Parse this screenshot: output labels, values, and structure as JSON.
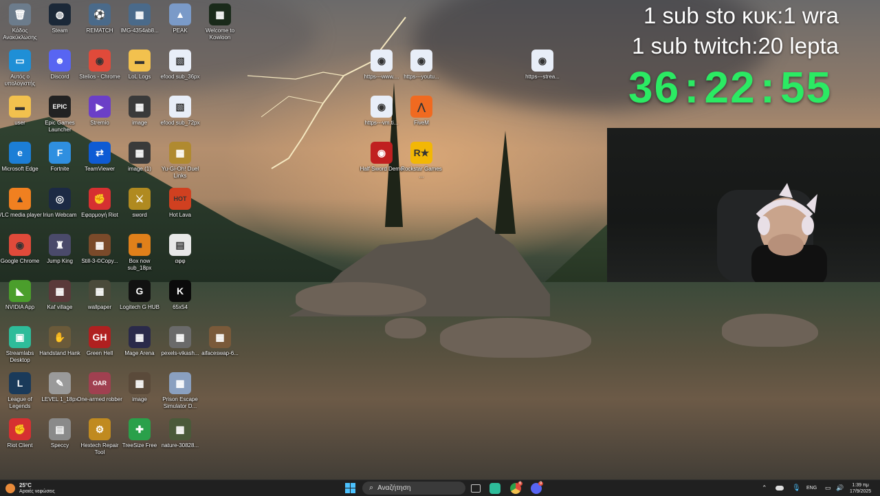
{
  "desktop": {
    "icons": [
      {
        "label": "Κάδος Ανακύκλωσης",
        "glyph": "🗑",
        "color": "#6c7c8c",
        "icon": "recycle-bin-icon"
      },
      {
        "label": "Αυτός ο υπολογιστής",
        "glyph": "▭",
        "color": "#1f8fd6",
        "icon": "this-pc-icon"
      },
      {
        "label": "user",
        "glyph": "▬",
        "color": "#f2c14e",
        "icon": "folder-icon"
      },
      {
        "label": "Microsoft Edge",
        "glyph": "e",
        "color": "#1c7ed6",
        "icon": "edge-icon"
      },
      {
        "label": "VLC media player",
        "glyph": "▲",
        "color": "#f08020",
        "icon": "vlc-icon"
      },
      {
        "label": "Google Chrome",
        "glyph": "◉",
        "color": "#e04a3a",
        "icon": "chrome-icon"
      },
      {
        "label": "NVIDIA App",
        "glyph": "◣",
        "color": "#4b9e2c",
        "icon": "nvidia-icon"
      },
      {
        "label": "Streamlabs Desktop",
        "glyph": "▣",
        "color": "#2ebc9a",
        "icon": "streamlabs-icon"
      },
      {
        "label": "League of Legends",
        "glyph": "L",
        "color": "#1a3a5a",
        "icon": "league-icon"
      },
      {
        "label": "Riot Client",
        "glyph": "✊",
        "color": "#d63031",
        "icon": "riot-client-icon"
      },
      {
        "label": "Steam",
        "glyph": "◍",
        "color": "#1b2838",
        "icon": "steam-icon"
      },
      {
        "label": "Discord",
        "glyph": "☻",
        "color": "#5865f2",
        "icon": "discord-icon"
      },
      {
        "label": "Epic Games Launcher",
        "glyph": "EPIC",
        "color": "#222",
        "icon": "epic-icon"
      },
      {
        "label": "Fortnite",
        "glyph": "F",
        "color": "#2f8fe0",
        "icon": "fortnite-icon"
      },
      {
        "label": "Iriun Webcam",
        "glyph": "◎",
        "color": "#1c2a44",
        "icon": "iriun-icon"
      },
      {
        "label": "Jump King",
        "glyph": "♜",
        "color": "#4a4a6a",
        "icon": "jump-king-icon"
      },
      {
        "label": "Kaf village",
        "glyph": "▦",
        "color": "#5a3a3a",
        "icon": "image-icon"
      },
      {
        "label": "Handstand Hank",
        "glyph": "✋",
        "color": "#6a5a3a",
        "icon": "game-icon"
      },
      {
        "label": "LEVEL 1_18px",
        "glyph": "✎",
        "color": "#9a9a9a",
        "icon": "file-icon"
      },
      {
        "label": "Speccy",
        "glyph": "▤",
        "color": "#8a8a8a",
        "icon": "speccy-icon"
      },
      {
        "label": "REMATCH",
        "glyph": "⚽",
        "color": "#4a6a8a",
        "icon": "rematch-icon"
      },
      {
        "label": "Stelios - Chrome",
        "glyph": "◉",
        "color": "#e04a3a",
        "icon": "chrome-icon"
      },
      {
        "label": "Stremio",
        "glyph": "▶",
        "color": "#6b3fc7",
        "icon": "stremio-icon"
      },
      {
        "label": "TeamViewer",
        "glyph": "⇄",
        "color": "#0e5bd4",
        "icon": "teamviewer-icon"
      },
      {
        "label": "Εφαρμογή Riot",
        "glyph": "✊",
        "color": "#d63031",
        "icon": "riot-app-icon"
      },
      {
        "label": "Still-3-©Copy...",
        "glyph": "▦",
        "color": "#7a4a2a",
        "icon": "image-icon"
      },
      {
        "label": "wallpaper",
        "glyph": "▦",
        "color": "#4a4a3a",
        "icon": "image-icon"
      },
      {
        "label": "Green Hell",
        "glyph": "GH",
        "color": "#b02020",
        "icon": "green-hell-icon"
      },
      {
        "label": "One-armed robber",
        "glyph": "OAR",
        "color": "#a04050",
        "icon": "one-armed-robber-icon"
      },
      {
        "label": "Hextech Repair Tool",
        "glyph": "⚙",
        "color": "#c08a20",
        "icon": "hextech-icon"
      },
      {
        "label": "IMG-4354ab8...",
        "glyph": "▦",
        "color": "#4a6a8a",
        "icon": "image-icon"
      },
      {
        "label": "LoL Logs",
        "glyph": "▬",
        "color": "#f2c14e",
        "icon": "folder-icon"
      },
      {
        "label": "image",
        "glyph": "▦",
        "color": "#3a3a3a",
        "icon": "image-icon"
      },
      {
        "label": "image (1)",
        "glyph": "▦",
        "color": "#3a3a3a",
        "icon": "image-icon"
      },
      {
        "label": "sword",
        "glyph": "⚔",
        "color": "#b08a20",
        "icon": "sword-icon"
      },
      {
        "label": "Box now sub_18px",
        "glyph": "■",
        "color": "#e0801a",
        "icon": "file-icon"
      },
      {
        "label": "Logitech G HUB",
        "glyph": "G",
        "color": "#111",
        "icon": "logitech-icon"
      },
      {
        "label": "Mage Arena",
        "glyph": "▦",
        "color": "#2a2a4a",
        "icon": "mage-arena-icon"
      },
      {
        "label": "image",
        "glyph": "▦",
        "color": "#5a4a3a",
        "icon": "image-icon"
      },
      {
        "label": "TreeSize Free",
        "glyph": "✚",
        "color": "#2aa04a",
        "icon": "treesize-icon"
      },
      {
        "label": "PEAK",
        "glyph": "▲",
        "color": "#7a9ac8",
        "icon": "peak-icon"
      },
      {
        "label": "efood sub_36px",
        "glyph": "▧",
        "color": "#e8eef8",
        "icon": "file-icon"
      },
      {
        "label": "efood sub_72px",
        "glyph": "▧",
        "color": "#e8eef8",
        "icon": "file-icon"
      },
      {
        "label": "Yu-Gi-Oh! Duel Links",
        "glyph": "▦",
        "color": "#b08a30",
        "icon": "yugioh-icon"
      },
      {
        "label": "Hot Lava",
        "glyph": "HOT",
        "color": "#d04020",
        "icon": "hot-lava-icon"
      },
      {
        "label": "αφφ",
        "glyph": "▤",
        "color": "#e8e8e8",
        "icon": "text-file-icon"
      },
      {
        "label": "65x54",
        "glyph": "K",
        "color": "#0a0a0a",
        "icon": "kick-icon"
      },
      {
        "label": "pexels-vikash...",
        "glyph": "▦",
        "color": "#6a6a6a",
        "icon": "image-icon"
      },
      {
        "label": "Prison Escape Simulator D...",
        "glyph": "▦",
        "color": "#8aa0c0",
        "icon": "prison-escape-icon"
      },
      {
        "label": "nature-30828...",
        "glyph": "▦",
        "color": "#4a5a3a",
        "icon": "image-icon"
      },
      {
        "label": "Welcome to Kowloon",
        "glyph": "▦",
        "color": "#1a2a1a",
        "icon": "kowloon-icon"
      },
      {
        "label": "aifaceswap-6...",
        "glyph": "▦",
        "color": "#7a5a3a",
        "icon": "image-icon"
      },
      {
        "label": "https---www....",
        "glyph": "◉",
        "color": "#e8eef8",
        "icon": "chrome-shortcut-icon"
      },
      {
        "label": "https---youtu...",
        "glyph": "◉",
        "color": "#e8eef8",
        "icon": "chrome-shortcut-icon"
      },
      {
        "label": "https---strea...",
        "glyph": "◉",
        "color": "#e8eef8",
        "icon": "chrome-shortcut-icon"
      },
      {
        "label": "https---vm.ti...",
        "glyph": "◉",
        "color": "#e8eef8",
        "icon": "chrome-shortcut-icon"
      },
      {
        "label": "FiveM",
        "glyph": "⋀",
        "color": "#f06a20",
        "icon": "fivem-icon"
      },
      {
        "label": "Half Sword Demo",
        "glyph": "◉",
        "color": "#c02020",
        "icon": "half-sword-icon"
      },
      {
        "label": "Rockstar Games ...",
        "glyph": "R★",
        "color": "#f2b705",
        "icon": "rockstar-icon"
      }
    ]
  },
  "overlay": {
    "line1": "1 sub sto κυκ:1 wra",
    "line2": "1 sub twitch:20 lepta",
    "timer": "36:22:55",
    "timer_color": "#2bea63"
  },
  "taskbar": {
    "weather_temp": "25°C",
    "weather_desc": "Αραιές νεφώσεις",
    "search_placeholder": "Αναζήτηση",
    "lang": "ENG",
    "time": "1:39 πμ",
    "date": "17/9/2025",
    "chrome_badge": "6",
    "discord_badge": "9"
  }
}
